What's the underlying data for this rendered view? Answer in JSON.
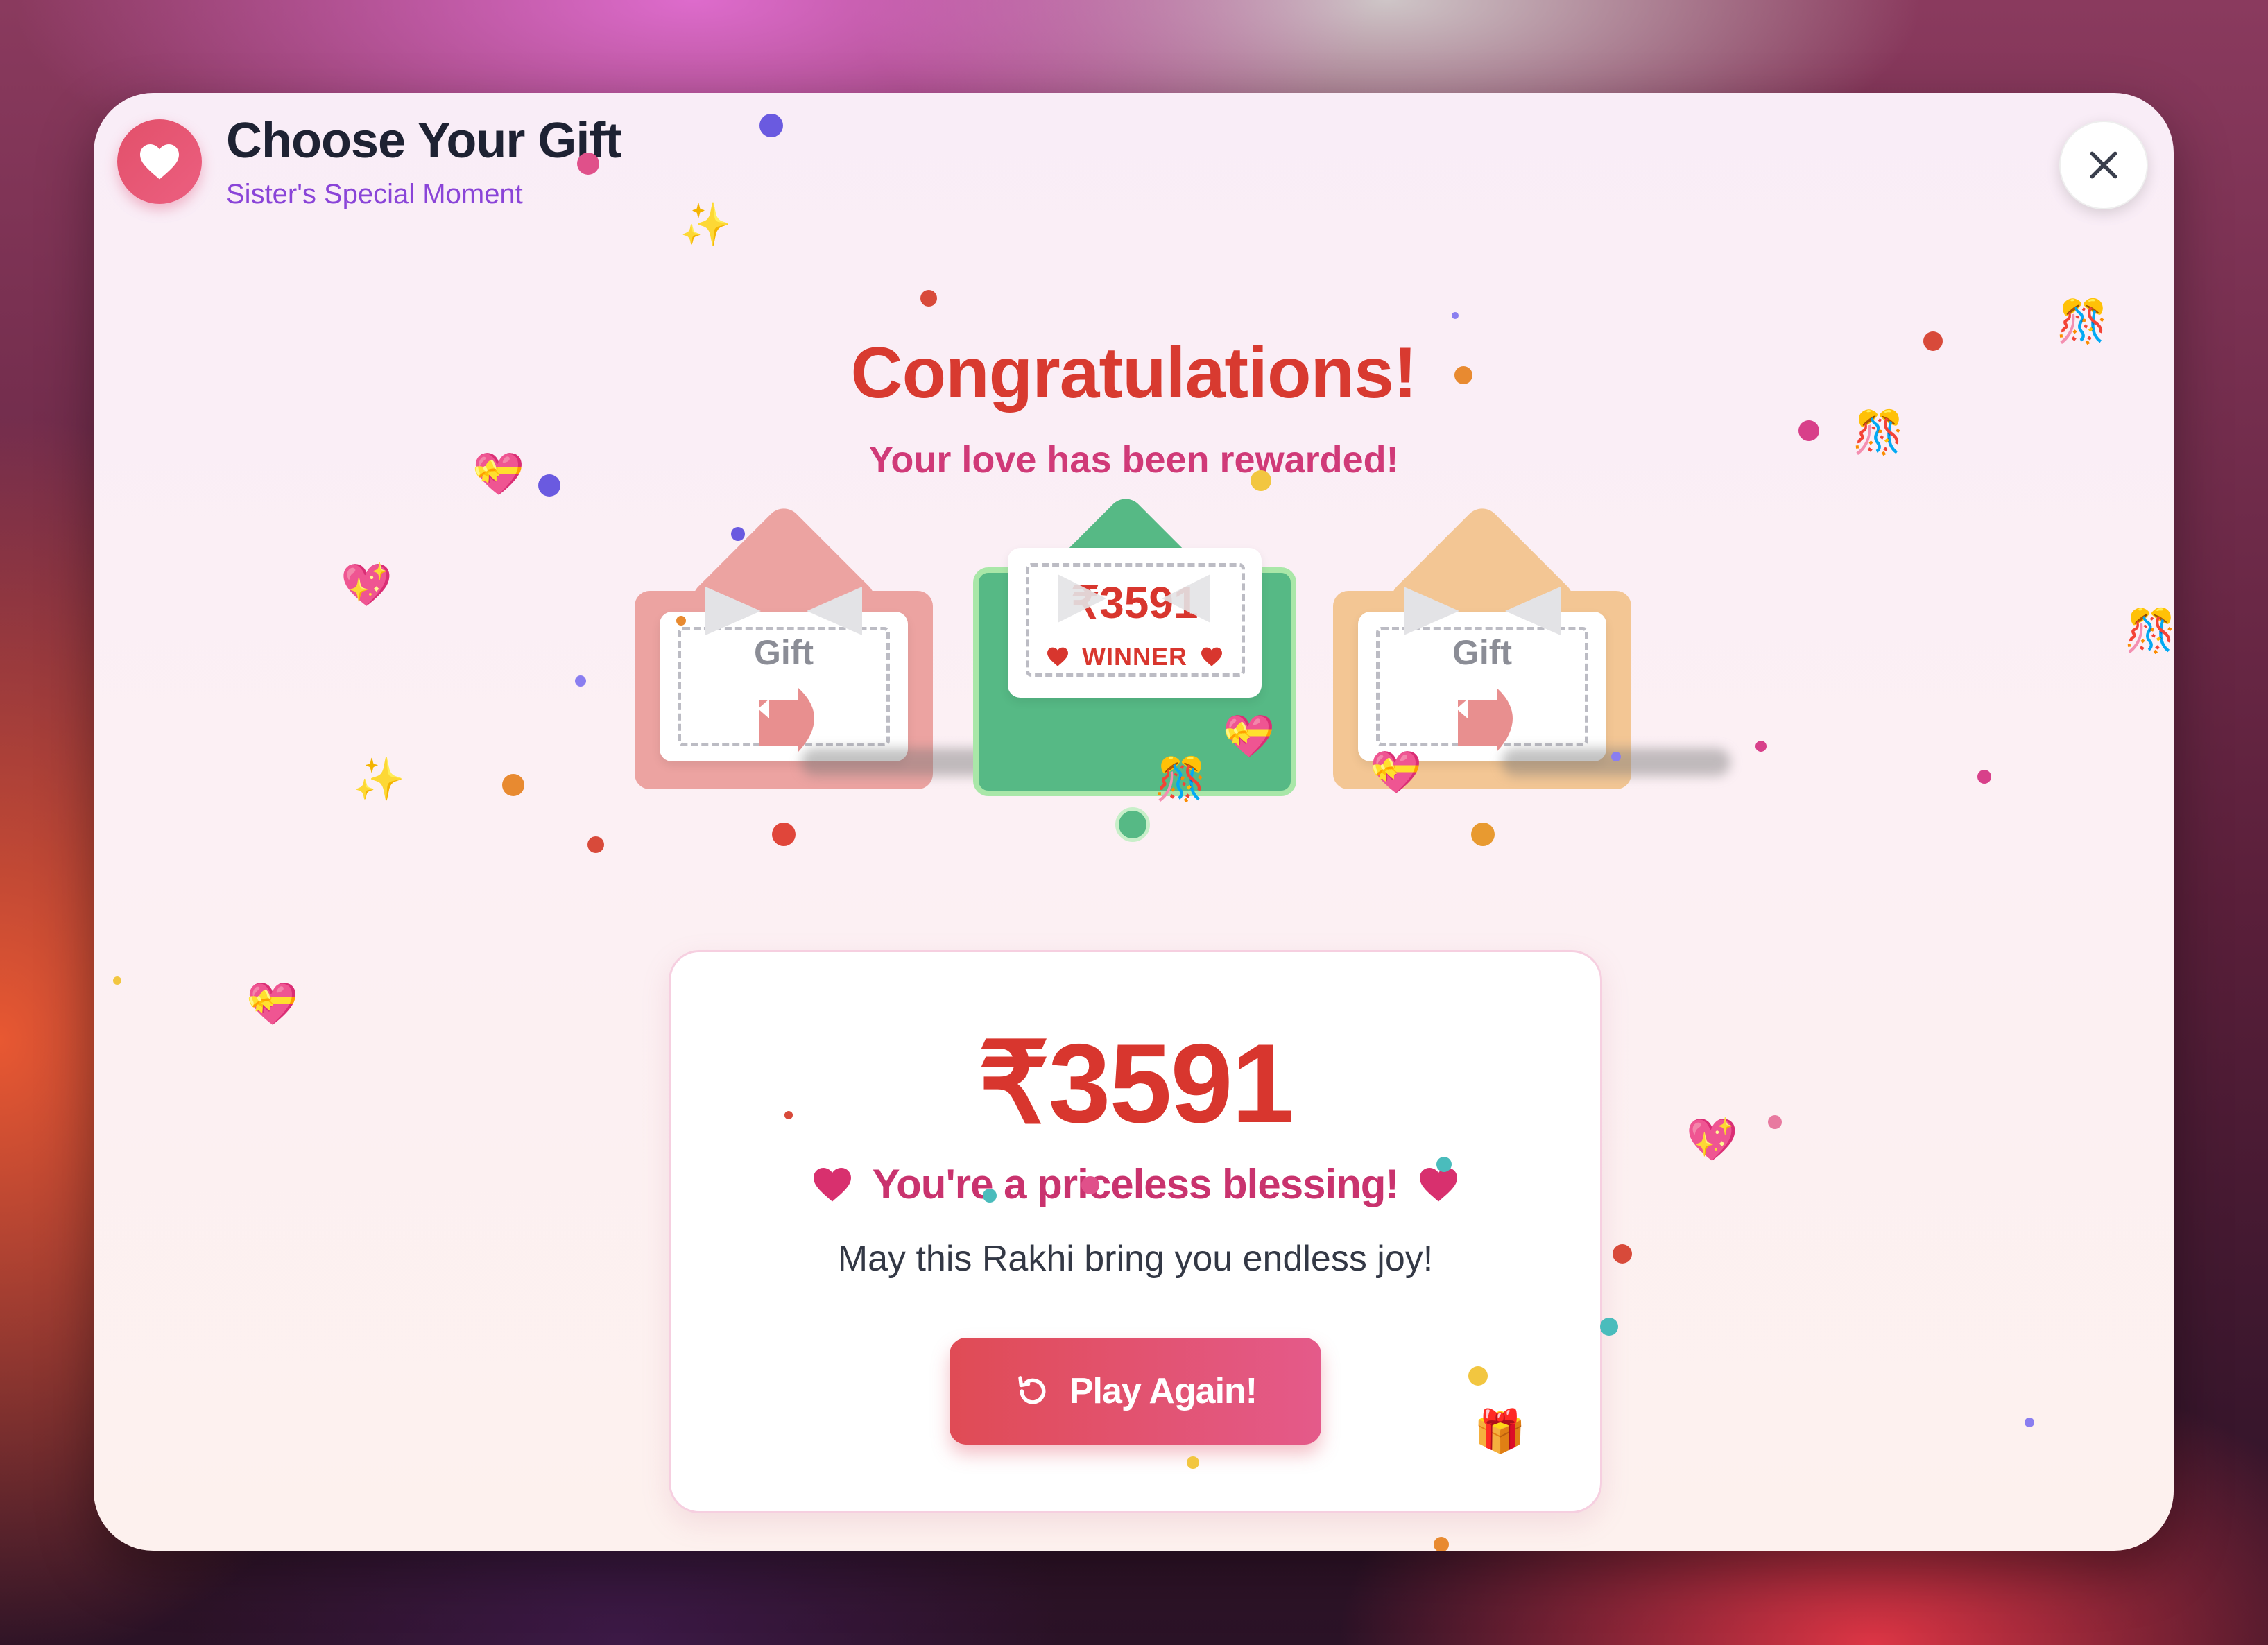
{
  "header": {
    "title": "Choose Your Gift",
    "subtitle": "Sister's Special Moment",
    "icon": "heart-icon",
    "close_icon": "close-icon"
  },
  "celebration": {
    "title": "Congratulations!",
    "subtitle": "Your love has been rewarded!"
  },
  "gifts": [
    {
      "label": "Gift",
      "color": "#eca3a1",
      "state": "unopened"
    },
    {
      "amount": "₹3591",
      "badge": "WINNER",
      "color": "#56b985",
      "state": "winner"
    },
    {
      "label": "Gift",
      "color": "#f3c694",
      "state": "unopened"
    }
  ],
  "result": {
    "amount": "₹3591",
    "message": "You're a priceless blessing!",
    "wish": "May this Rakhi bring you endless joy!",
    "button_label": "Play Again!",
    "button_icon": "refresh-icon"
  },
  "colors": {
    "primary_red": "#d8362e",
    "pink": "#c9336e",
    "purple": "#8a44d8",
    "winner_green": "#56b985"
  },
  "confetti_emojis": [
    "💝",
    "💖",
    "🎁",
    "✨",
    "🎊"
  ]
}
